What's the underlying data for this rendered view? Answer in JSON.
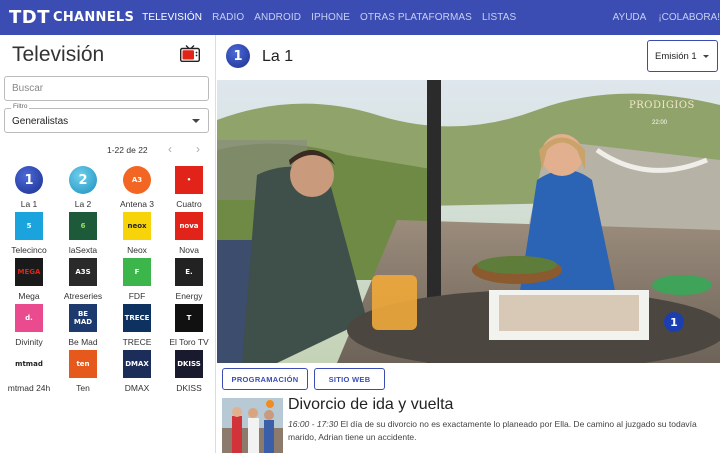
{
  "brand": {
    "tdt": "TDT",
    "channels": "CHANNELS"
  },
  "nav": {
    "items": [
      {
        "label": "TELEVISIÓN",
        "active": true
      },
      {
        "label": "RADIO",
        "active": false
      },
      {
        "label": "ANDROID",
        "active": false
      },
      {
        "label": "IPHONE",
        "active": false
      },
      {
        "label": "OTRAS PLATAFORMAS",
        "active": false
      },
      {
        "label": "LISTAS",
        "active": false
      }
    ],
    "right": [
      {
        "label": "AYUDA"
      },
      {
        "label": "¡COLABORA!"
      }
    ]
  },
  "sidebar": {
    "title": "Televisión",
    "search_placeholder": "Buscar",
    "filter_legend": "Filtro",
    "filter_value": "Generalistas",
    "pager": "1-22 de 22",
    "prev": "‹",
    "next": "›",
    "channels": [
      {
        "name": "La 1",
        "logo": "1",
        "bg": "#ffffff",
        "fg": "#fff"
      },
      {
        "name": "La 2",
        "logo": "2",
        "bg": "#ffffff",
        "fg": "#fff"
      },
      {
        "name": "Antena 3",
        "logo": "A3",
        "bg": "#f26522",
        "fg": "#fff"
      },
      {
        "name": "Cuatro",
        "logo": "•",
        "bg": "#e2231a",
        "fg": "#fff"
      },
      {
        "name": "Telecinco",
        "logo": "5",
        "bg": "#1aa3dd",
        "fg": "#fff"
      },
      {
        "name": "laSexta",
        "logo": "6",
        "bg": "#1d5a3a",
        "fg": "#9be04a"
      },
      {
        "name": "Neox",
        "logo": "neox",
        "bg": "#f7d40a",
        "fg": "#222"
      },
      {
        "name": "Nova",
        "logo": "nova",
        "bg": "#e2231a",
        "fg": "#fff"
      },
      {
        "name": "Mega",
        "logo": "MEGA",
        "bg": "#1a1a1a",
        "fg": "#e2231a"
      },
      {
        "name": "Atreseries",
        "logo": "A3S",
        "bg": "#2a2a2a",
        "fg": "#fff"
      },
      {
        "name": "FDF",
        "logo": "F",
        "bg": "#3cb64a",
        "fg": "#fff"
      },
      {
        "name": "Energy",
        "logo": "E.",
        "bg": "#222222",
        "fg": "#fff"
      },
      {
        "name": "Divinity",
        "logo": "d.",
        "bg": "#ea4b8e",
        "fg": "#fff"
      },
      {
        "name": "Be Mad",
        "logo": "BE MAD",
        "bg": "#1d3a6e",
        "fg": "#fff"
      },
      {
        "name": "TRECE",
        "logo": "TRECE",
        "bg": "#0e3260",
        "fg": "#fff"
      },
      {
        "name": "El Toro TV",
        "logo": "T",
        "bg": "#111111",
        "fg": "#fff"
      },
      {
        "name": "mtmad 24h",
        "logo": "mtmad",
        "bg": "#ffffff",
        "fg": "#222"
      },
      {
        "name": "Ten",
        "logo": "ten",
        "bg": "#e55a1c",
        "fg": "#fff"
      },
      {
        "name": "DMAX",
        "logo": "DMAX",
        "bg": "#1d2d5a",
        "fg": "#fff"
      },
      {
        "name": "DKISS",
        "logo": "DKISS",
        "bg": "#1a1a2e",
        "fg": "#fff"
      }
    ]
  },
  "main": {
    "channel_logo": "1",
    "channel_title": "La 1",
    "emision_label": "Emisión 1",
    "video_watermark": "PRODIGIOS",
    "video_time": "22:00",
    "video_logo": "1",
    "buttons": {
      "programacion": "PROGRAMACIÓN",
      "sitio_web": "SITIO WEB"
    },
    "program": {
      "title": "Divorcio de ida y vuelta",
      "time": "16:00 - 17:30",
      "description": "El día de su divorcio no es exactamente lo planeado por Ella. De camino al juzgado su todavía marido, Adrian tiene un accidente."
    }
  },
  "colors": {
    "accent": "#3b4db3"
  }
}
